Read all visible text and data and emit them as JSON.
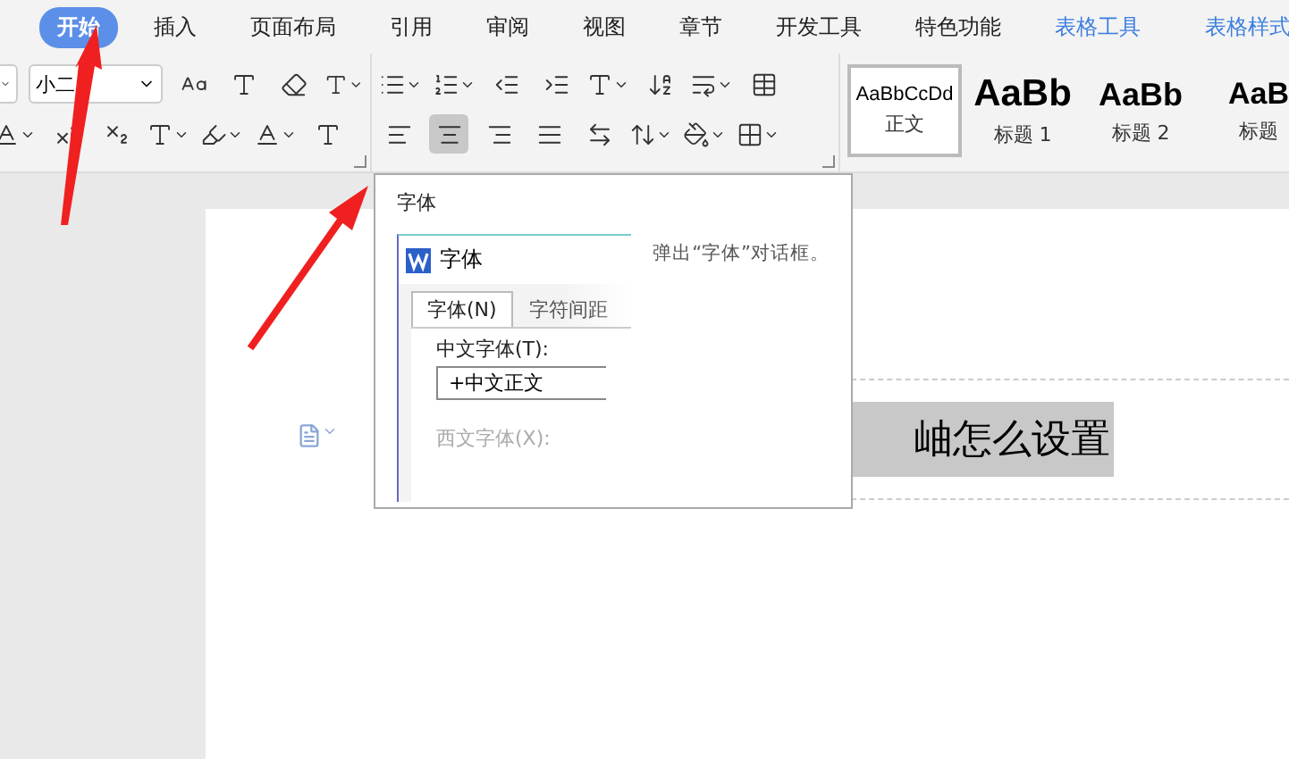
{
  "menu_tabs": [
    {
      "label": "开始",
      "selected": true,
      "kind": "main"
    },
    {
      "label": "插入",
      "selected": false,
      "kind": "main"
    },
    {
      "label": "页面布局",
      "selected": false,
      "kind": "main"
    },
    {
      "label": "引用",
      "selected": false,
      "kind": "main"
    },
    {
      "label": "审阅",
      "selected": false,
      "kind": "main"
    },
    {
      "label": "视图",
      "selected": false,
      "kind": "main"
    },
    {
      "label": "章节",
      "selected": false,
      "kind": "main"
    },
    {
      "label": "开发工具",
      "selected": false,
      "kind": "main"
    },
    {
      "label": "特色功能",
      "selected": false,
      "kind": "main"
    },
    {
      "label": "表格工具",
      "selected": false,
      "kind": "contextual"
    },
    {
      "label": "表格样式",
      "selected": false,
      "kind": "contextual"
    }
  ],
  "font_group": {
    "font_size": "小二"
  },
  "paragraph_group": {
    "align_buttons": [
      {
        "kind": "left",
        "selected": false
      },
      {
        "kind": "center",
        "selected": true
      },
      {
        "kind": "right",
        "selected": false
      },
      {
        "kind": "justify",
        "selected": false
      },
      {
        "kind": "distribute",
        "selected": false
      }
    ]
  },
  "styles": [
    {
      "preview": "AaBbCcDd",
      "label": "正文",
      "selected": true,
      "kind": "body"
    },
    {
      "preview": "AaBb",
      "label": "标题 1",
      "selected": false,
      "kind": "h1"
    },
    {
      "preview": "AaBb",
      "label": "标题 2",
      "selected": false,
      "kind": "h2"
    },
    {
      "preview": "AaB",
      "label": "标题",
      "selected": false,
      "kind": "h3"
    }
  ],
  "tooltip": {
    "title": "字体",
    "description": "弹出“字体”对话框。",
    "dialog": {
      "title": "字体",
      "tabs": [
        {
          "label": "字体(N)",
          "selected": true
        },
        {
          "label": "字符间距",
          "selected": false
        }
      ],
      "chinese_font_label": "中文字体(T):",
      "chinese_font_value": "+中文正文",
      "western_font_label": "西文字体(X):"
    }
  },
  "document": {
    "text": "岫怎么设置"
  }
}
